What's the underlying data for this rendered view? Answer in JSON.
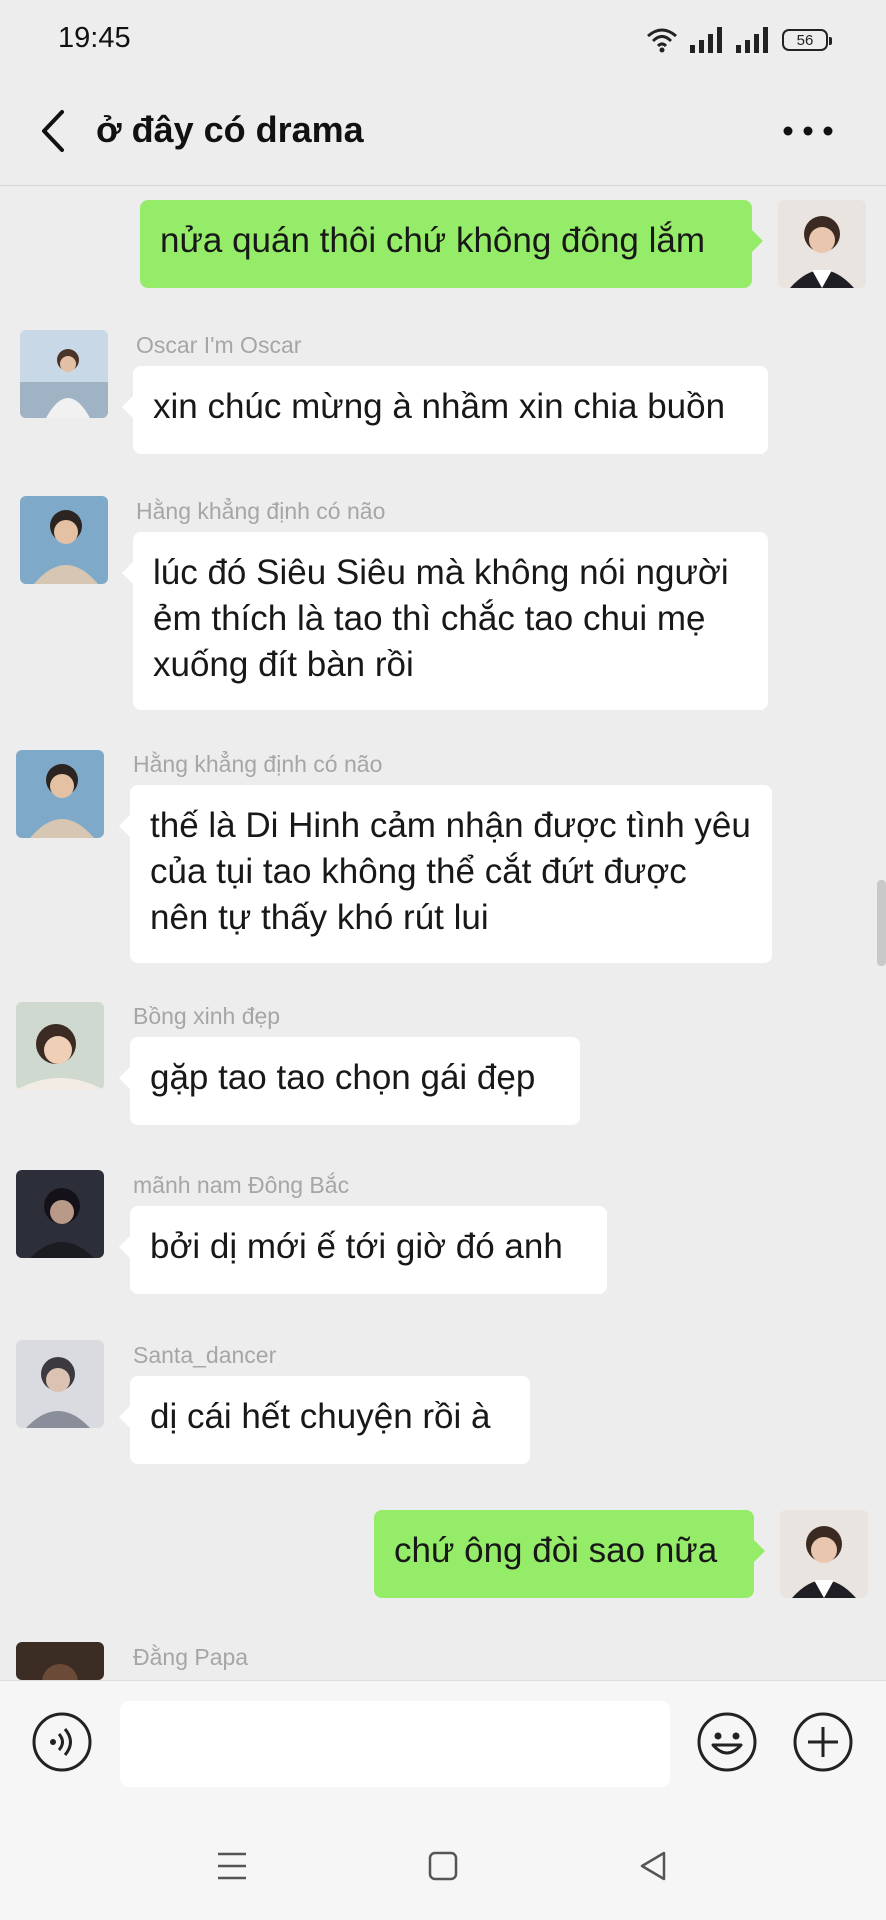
{
  "status": {
    "time": "19:45",
    "battery": "56"
  },
  "header": {
    "title": "ở đây có drama",
    "back_icon": "chevron-left-icon",
    "more_icon": "more-dots-icon"
  },
  "messages": [
    {
      "side": "right",
      "text": "nửa quán thôi chứ không đông lắm"
    },
    {
      "side": "left",
      "sender": "Oscar I'm Oscar",
      "text": "xin chúc mừng à nhầm xin chia buồn"
    },
    {
      "side": "left",
      "sender": "Hằng khẳng định có não",
      "text": "lúc đó Siêu Siêu mà không nói người ẻm thích là tao thì chắc tao chui mẹ xuống đít bàn rồi"
    },
    {
      "side": "left",
      "sender": "Hằng khẳng định có não",
      "text": "thế là Di Hinh cảm nhận được tình yêu của tụi tao không thể cắt đứt được nên tự thấy khó rút lui"
    },
    {
      "side": "left",
      "sender": "Bồng xinh đẹp",
      "text": "gặp tao tao chọn gái đẹp"
    },
    {
      "side": "left",
      "sender": "mãnh nam Đông Bắc",
      "text": "bởi dị mới ế tới giờ đó anh"
    },
    {
      "side": "left",
      "sender": "Santa_dancer",
      "text": "dị cái hết chuyện rồi à"
    },
    {
      "side": "right",
      "text": "chứ ông đòi sao nữa"
    },
    {
      "side": "left",
      "sender": "Đằng Papa",
      "text": ""
    }
  ],
  "input": {
    "placeholder": "",
    "voice_icon": "voice-icon",
    "emoji_icon": "emoji-icon",
    "plus_icon": "plus-icon"
  },
  "navbar": {
    "menu_icon": "menu-icon",
    "home_icon": "home-square-icon",
    "back_icon": "back-triangle-icon"
  },
  "colors": {
    "bubble_self": "#95ec69",
    "bubble_other": "#ffffff",
    "background": "#ededed"
  }
}
